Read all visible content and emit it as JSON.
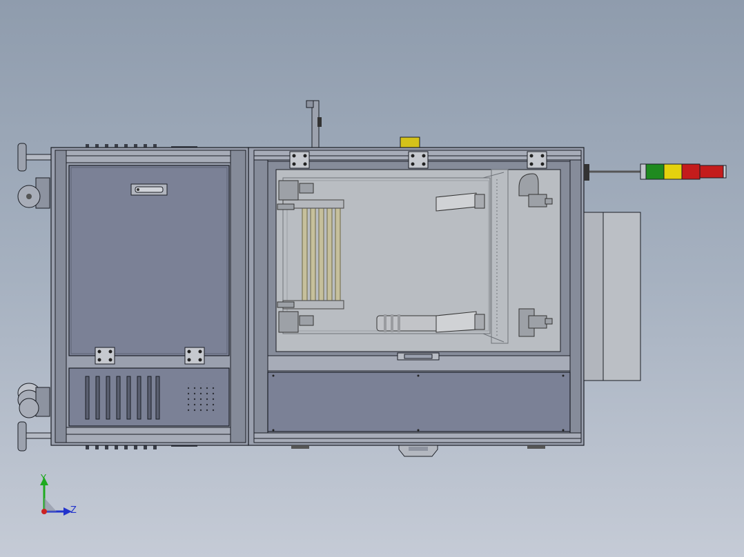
{
  "viewport": {
    "background_top": "#8f9cad",
    "background_bottom": "#c5cbd6",
    "metal_color": "#7b8196",
    "frame_color": "#9aa0ae",
    "edge_color": "#1a1d24",
    "glass_color": "#b9bdc2"
  },
  "stack_light": {
    "segments": [
      {
        "name": "green",
        "color": "#1f8a1f"
      },
      {
        "name": "yellow",
        "color": "#e4d20e"
      },
      {
        "name": "red",
        "color": "#c41c1c"
      }
    ]
  },
  "top_indicator": {
    "color": "#d4c21a"
  },
  "triad": {
    "y_label": "Y",
    "z_label": "Z",
    "y_color": "#1faa1f",
    "z_color": "#2233cc",
    "origin_color": "#cc2222"
  }
}
